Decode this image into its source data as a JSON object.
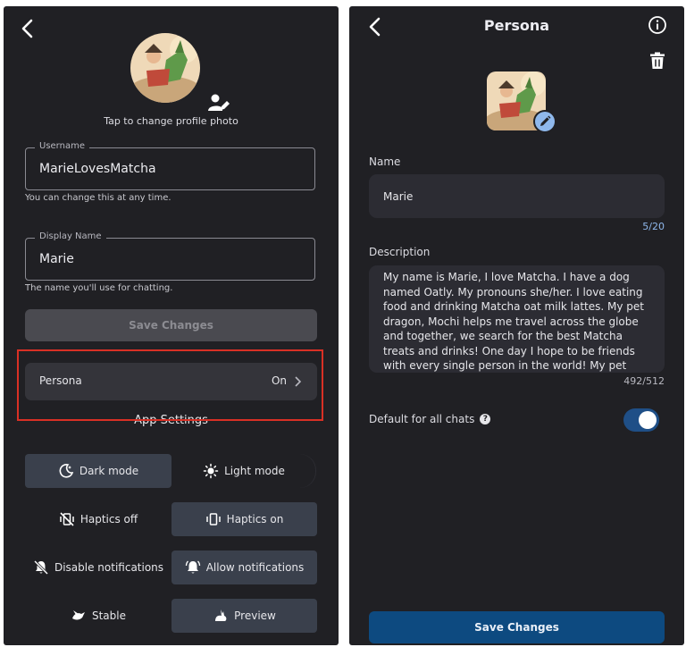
{
  "left": {
    "tap_text": "Tap to change profile photo",
    "username": {
      "label": "Username",
      "value": "MarieLovesMatcha",
      "helper": "You can change this at any time."
    },
    "display_name": {
      "label": "Display Name",
      "value": "Marie",
      "helper": "The name you'll use for chatting."
    },
    "save_label": "Save Changes",
    "persona": {
      "label": "Persona",
      "value": "On"
    },
    "app_settings": "App Settings",
    "theme": {
      "dark": "Dark mode",
      "light": "Light mode",
      "selected": "dark"
    },
    "haptics": {
      "off": "Haptics off",
      "on": "Haptics on",
      "selected": "on"
    },
    "notifications": {
      "off": "Disable notifications",
      "on": "Allow notifications",
      "selected": "on"
    },
    "channel": {
      "stable": "Stable",
      "preview": "Preview",
      "selected": "preview"
    }
  },
  "right": {
    "title": "Persona",
    "name_label": "Name",
    "name_value": "Marie",
    "name_count": "5/20",
    "description_label": "Description",
    "description_value": "My name is Marie, I love Matcha. I have a dog named Oatly. My pronouns she/her. I love eating food and drinking Matcha oat milk lattes. My pet dragon, Mochi helps me travel across the globe and together, we search for the best Matcha treats and drinks! One day I hope to be friends with every single person in the world! My pet dragon, Mochi",
    "description_count": "492/512",
    "default_label": "Default for all chats",
    "default_on": true,
    "save_label": "Save Changes"
  },
  "colors": {
    "panel_bg": "#202024",
    "highlight": "#d93025",
    "accent": "#8fb8ec",
    "primary_button": "#0d4a80",
    "toggle_track": "#1f4f87"
  },
  "icons": [
    "chevron-left-icon",
    "person-edit-icon",
    "chevron-right-icon",
    "moon-icon",
    "sun-icon",
    "haptics-off-icon",
    "haptics-on-icon",
    "bell-off-icon",
    "bell-ring-icon",
    "bird-icon",
    "rabbit-icon",
    "info-icon",
    "trash-icon",
    "pencil-icon",
    "help-icon"
  ]
}
